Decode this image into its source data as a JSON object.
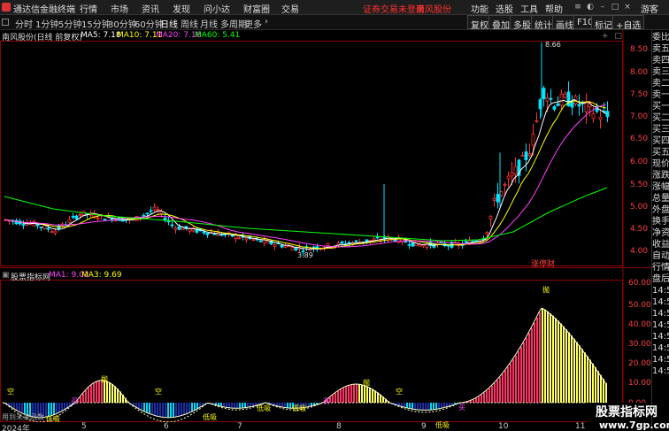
{
  "titlebar": {
    "app_title": "通达信金融终端",
    "menus": [
      "行情",
      "市场",
      "资讯",
      "发现",
      "问小达",
      "财富圈",
      "交易"
    ],
    "warning": "证券交易未登录",
    "stock_name": "南风股份",
    "right_menus": [
      "功能",
      "选股",
      "工具",
      "帮助",
      "游客"
    ]
  },
  "toolbar": {
    "periods": [
      "分时",
      "1分钟",
      "5分钟",
      "15分钟",
      "30分钟",
      "60分钟",
      "日线",
      "周线",
      "月线",
      "多周期",
      "更多"
    ],
    "active_period": "日线",
    "right_tabs": [
      "复权",
      "叠加",
      "多股",
      "统计",
      "画线",
      "F10",
      "标记",
      "+自选"
    ]
  },
  "main_chart": {
    "title": "南风股份(日线 前复权)",
    "ma5": "MA5: 7.18",
    "ma10": "MA10: 7.11",
    "ma20": "MA20: 7.16",
    "ma60": "MA60: 5.41",
    "high_label": "8.66",
    "low_label": "3.89",
    "badge": "涨停财",
    "y_ticks": [
      "8.50",
      "8.00",
      "7.50",
      "7.00",
      "6.50",
      "6.00",
      "5.50",
      "5.00",
      "4.50",
      "4.00"
    ],
    "colors": {
      "up": "#ff3030",
      "down": "#00e5ff",
      "ma5": "#ffffff",
      "ma10": "#ffff00",
      "ma20": "#ff40ff",
      "ma60": "#00ff00"
    }
  },
  "sub_chart": {
    "title": "股票指标网",
    "ma1": "MA1: 9.02",
    "ma3": "MA3: 9.69",
    "y_ticks": [
      "60.00",
      "50.00",
      "40.00",
      "30.00",
      "20.00",
      "10.00",
      "0.00"
    ],
    "labels": {
      "pao1": "抛",
      "pao2": "抛",
      "pao3": "抛",
      "kong1": "空",
      "kong2": "空",
      "kong3": "空",
      "mai1": "买",
      "mai2": "买",
      "mai3": "买",
      "diji1": "低吸",
      "diji2": "低吸",
      "diji3": "低吸",
      "diji4": "低吸",
      "diji5": "低吸"
    },
    "footer_text": "用到未来函数"
  },
  "side_panel": {
    "items": [
      "委比",
      "卖五",
      "卖四",
      "卖三",
      "卖二",
      "卖一",
      "买一",
      "买二",
      "买三",
      "买四",
      "买五",
      "现价",
      "涨跌",
      "涨幅",
      "总量",
      "外盘",
      "换手",
      "净资",
      "收益",
      "自动",
      "行情",
      "盘后",
      "14:50",
      "14:50",
      "14:50",
      "14:50",
      "14:50",
      "14:50",
      "14:50",
      "14:50"
    ]
  },
  "xaxis": {
    "labels": [
      "2024年",
      "5",
      "6",
      "7",
      "8",
      "9",
      "10",
      "11"
    ]
  },
  "watermark": {
    "text": "股票指标网",
    "url": "www.7gp.com"
  }
}
